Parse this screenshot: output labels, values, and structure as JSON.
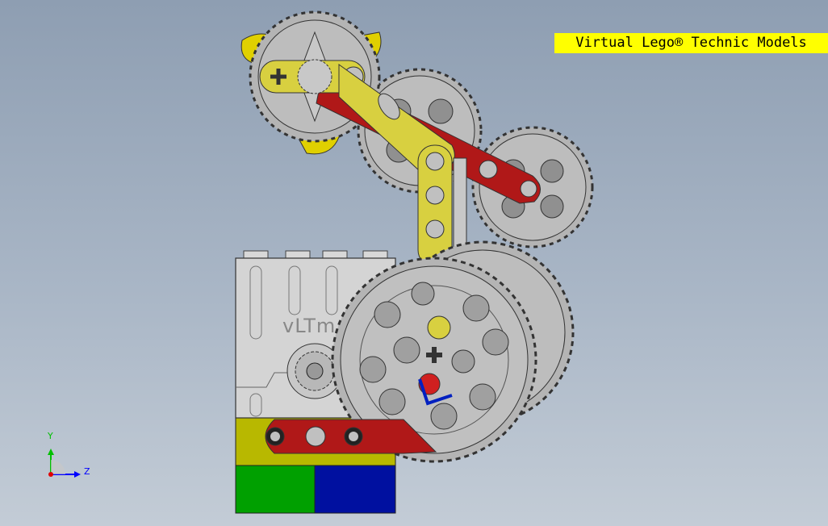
{
  "banner": {
    "text": "Virtual Lego® Technic Models"
  },
  "model": {
    "brick_text": "vLTm"
  },
  "triad": {
    "y_label": "Y",
    "z_label": "Z"
  },
  "colors": {
    "background_top": "#8e9eb2",
    "banner": "#ffff00",
    "gear_gray": "#b4b4b4",
    "beam_red": "#b01818",
    "beam_yellow": "#d8d040",
    "brick_green": "#00a000",
    "brick_blue": "#0010a0",
    "brick_olive": "#b8b800",
    "axis_y": "#00c000",
    "axis_z": "#0000ff"
  }
}
